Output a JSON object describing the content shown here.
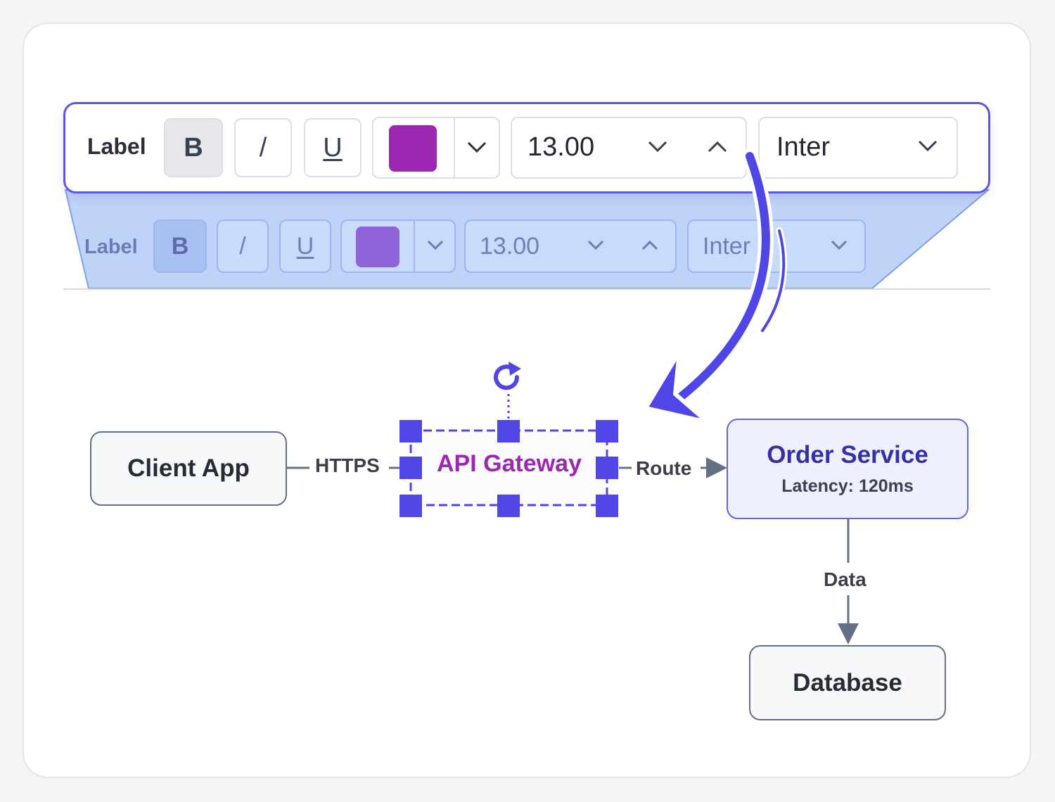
{
  "toolbar": {
    "label": "Label",
    "bold": "B",
    "italic": "/",
    "underline": "U",
    "color": "#9c27b0",
    "font_size": "13.00",
    "font_family": "Inter"
  },
  "ghost_toolbar": {
    "label": "Label",
    "bold": "B",
    "italic": "/",
    "underline": "U",
    "color": "#9063d8",
    "font_size": "13.00",
    "font_family": "Inter"
  },
  "diagram": {
    "nodes": {
      "client": "Client App",
      "gateway": "API Gateway",
      "order": "Order Service",
      "order_sub": "Latency: 120ms",
      "database": "Database"
    },
    "edges": {
      "https": "HTTPS",
      "route": "Route",
      "data": "Data"
    },
    "gateway_text_color": "#9c27b0",
    "selection_color": "#4f46e5"
  }
}
